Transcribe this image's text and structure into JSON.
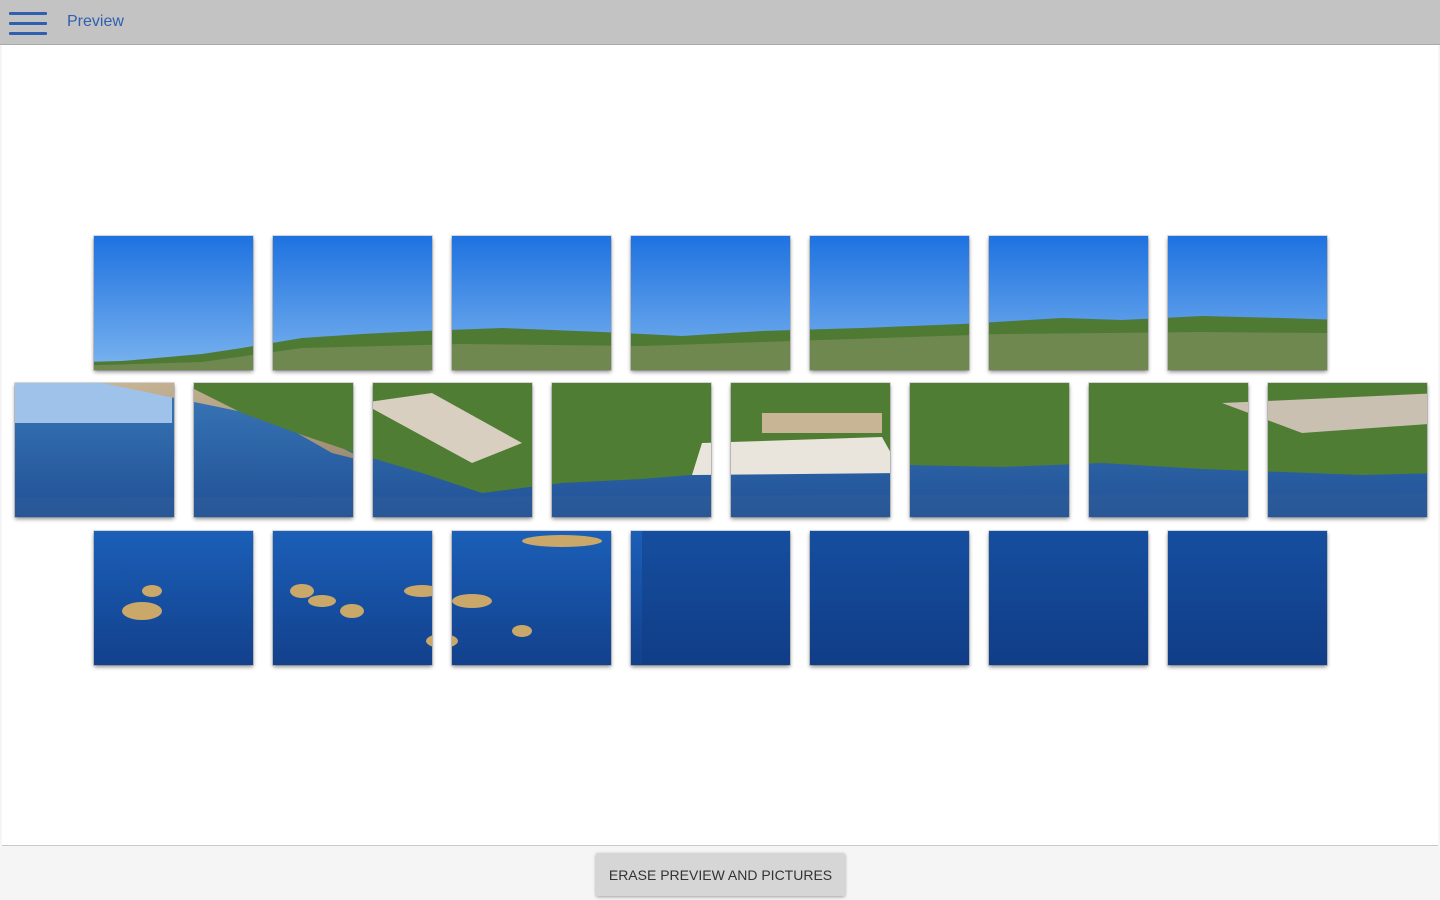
{
  "header": {
    "title": "Preview",
    "menu_icon": "hamburger-menu-icon",
    "accent_color": "#2f5fae"
  },
  "preview": {
    "grid": [
      7,
      8,
      7
    ],
    "scene": "coastal panorama (sky, hills, cliffs, sea)"
  },
  "footer": {
    "erase_label": "ERASE PREVIEW AND PICTURES"
  }
}
